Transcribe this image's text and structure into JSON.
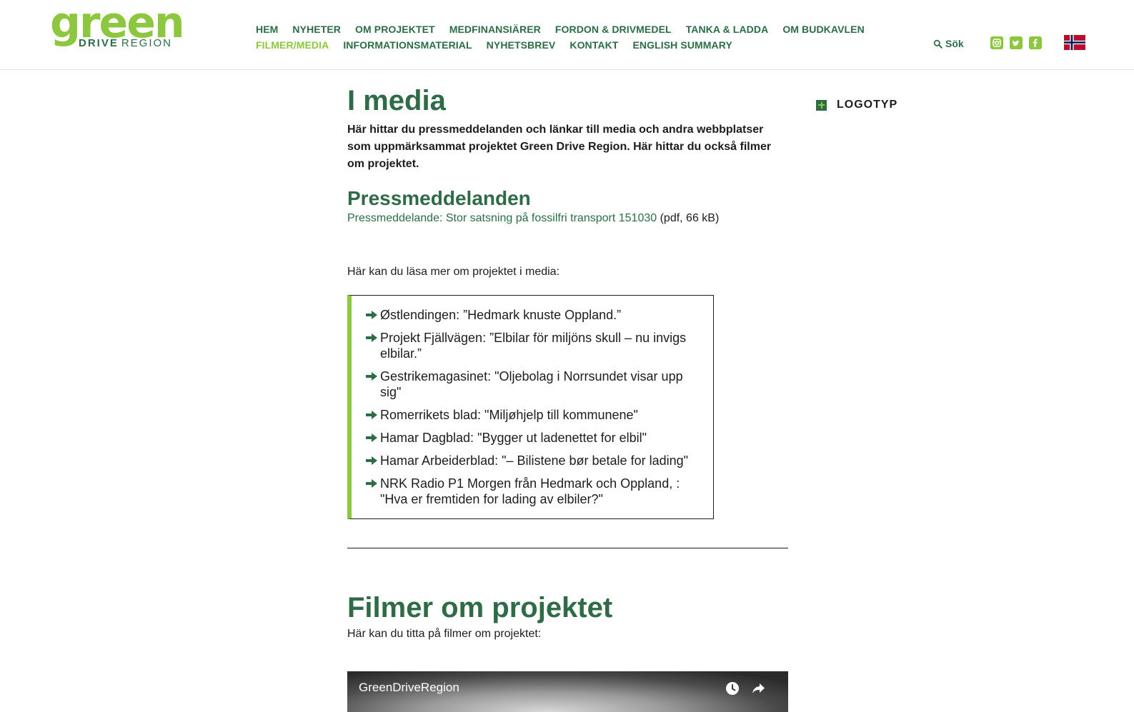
{
  "colors": {
    "brand_dark_green": "#2e6b46",
    "brand_light_green": "#8dc63f",
    "text": "#1d1d1b"
  },
  "logo": {
    "word": "green",
    "drive": "DRIVE",
    "region": "REGION"
  },
  "nav": {
    "row1": [
      "HEM",
      "NYHETER",
      "OM PROJEKTET",
      "MEDFINANSIÄRER",
      "FORDON & DRIVMEDEL",
      "TANKA & LADDA",
      "OM BUDKAVLEN"
    ],
    "row2": [
      "FILMER/MEDIA",
      "INFORMATIONSMATERIAL",
      "NYHETSBREV",
      "KONTAKT",
      "ENGLISH SUMMARY"
    ],
    "active": "FILMER/MEDIA"
  },
  "search": {
    "label": "Sök",
    "icon": "search-icon"
  },
  "social": [
    "instagram-icon",
    "twitter-icon",
    "facebook-icon"
  ],
  "language_flag": "norwegian-flag-icon",
  "main": {
    "title": "I media",
    "lead": "Här hittar du pressmeddelanden och länkar till media och andra webbplatser som uppmärksammat projektet Green Drive Region. Här hittar du också filmer om projektet.",
    "press_heading": "Pressmeddelanden",
    "press_link": "Pressmeddelande: Stor satsning på fossilfri transport 151030",
    "press_meta": "(pdf, 66 kB)",
    "media_intro": "Här kan du läsa mer om projektet i media:",
    "media_items": [
      "Østlendingen: ”Hedmark knuste Oppland.”",
      "Projekt Fjällvägen: ”Elbilar för miljöns skull – nu invigs elbilar.”",
      "Gestrikemagasinet: \"Oljebolag i Norrsundet visar upp sig\"",
      "Romerrikets blad: \"Miljøhjelp till kommunene\"",
      "Hamar Dagblad: \"Bygger ut ladenettet for elbil\"",
      "Hamar Arbeiderblad: \"– Bilistene bør betale for lading\"",
      "NRK Radio P1 Morgen från Hedmark och Oppland, : \"Hva er fremtiden for lading av elbiler?\""
    ],
    "films_heading": "Filmer om projektet",
    "films_intro": "Här kan du titta på filmer om projektet:"
  },
  "video": {
    "title": "GreenDriveRegion",
    "controls": [
      "watch-later-icon",
      "share-icon"
    ]
  },
  "sidebar": {
    "label": "LOGOTYP",
    "icon": "plus-icon"
  }
}
